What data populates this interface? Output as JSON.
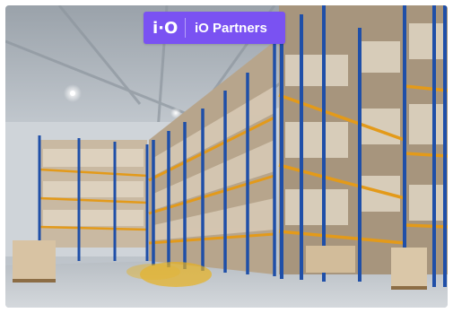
{
  "badge": {
    "logo_text": "i·O",
    "name": "iO Partners",
    "color": "#7a52f2"
  },
  "photo": {
    "subject": "warehouse-interior",
    "colors": {
      "rack_upright": "#1f4fa8",
      "rack_beam": "#e39a1a",
      "forklift": "#e8b21c"
    }
  }
}
